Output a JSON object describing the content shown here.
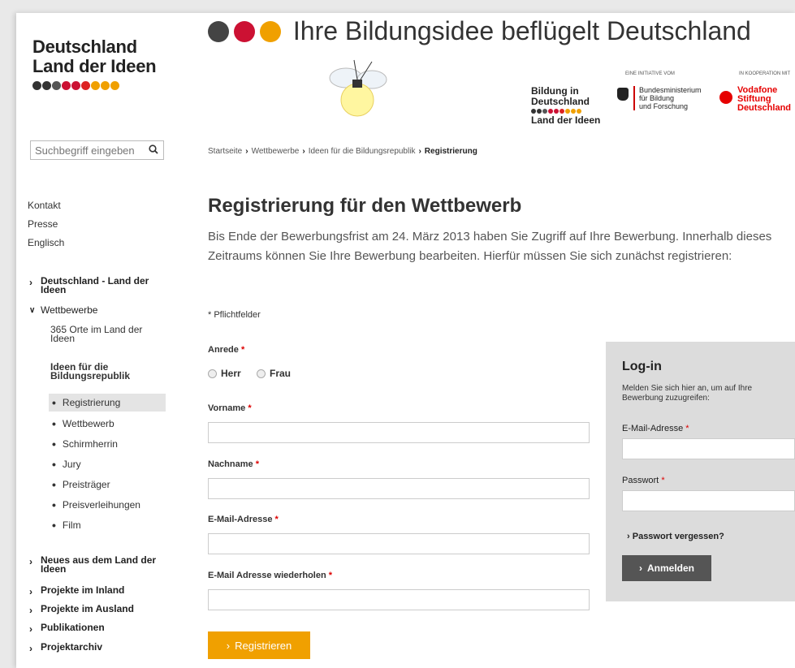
{
  "logo": {
    "line1": "Deutschland",
    "line2": "Land der Ideen",
    "flower_colors": [
      "#333333",
      "#333333",
      "#555555",
      "#cc1133",
      "#cc1133",
      "#dd2222",
      "#f0a000",
      "#f0a000",
      "#f0a000"
    ]
  },
  "banner": {
    "title": "Ihre Bildungsidee beflügelt Deutschland",
    "flower_colors": [
      "#444444",
      "#cc1133",
      "#f0a000"
    ],
    "partner1": {
      "line1": "Bildung in",
      "line2": "Deutschland",
      "line3": "Land der Ideen"
    },
    "initiative_caption": "EINE INITIATIVE VOM",
    "ministry": {
      "line1": "Bundesministerium",
      "line2": "für Bildung",
      "line3": "und Forschung"
    },
    "cooperation_caption": "IN KOOPERATION MIT",
    "vodafone": {
      "line1": "Vodafone",
      "line2": "Stiftung",
      "line3": "Deutschland"
    }
  },
  "search": {
    "placeholder": "Suchbegriff eingeben"
  },
  "util_links": [
    "Kontakt",
    "Presse",
    "Englisch"
  ],
  "nav": {
    "deutschland": "Deutschland - Land der Ideen",
    "wettbewerbe": "Wettbewerbe",
    "orte": "365 Orte im Land der Ideen",
    "ideen": "Ideen für die Bildungsrepublik",
    "bullets": [
      "Registrierung",
      "Wettbewerb",
      "Schirmherrin",
      "Jury",
      "Preisträger",
      "Preisverleihungen",
      "Film"
    ],
    "neues": "Neues aus dem Land der Ideen",
    "inland": "Projekte im Inland",
    "ausland": "Projekte im Ausland",
    "publikationen": "Publikationen",
    "archiv": "Projektarchiv"
  },
  "breadcrumb": [
    "Startseite",
    "Wettbewerbe",
    "Ideen für die Bildungsrepublik",
    "Registrierung"
  ],
  "main": {
    "title": "Registrierung für den Wettbewerb",
    "intro": "Bis Ende der Bewerbungsfrist am 24. März 2013 haben Sie Zugriff auf Ihre Bewerbung. Innerhalb dieses Zeitraums können Sie Ihre Bewerbung bearbeiten. Hierfür müssen Sie sich zunächst registrieren:",
    "required_note": "* Pflichtfelder",
    "anrede_label": "Anrede",
    "herr": "Herr",
    "frau": "Frau",
    "vorname_label": "Vorname",
    "nachname_label": "Nachname",
    "email_label": "E-Mail-Adresse",
    "email_repeat_label": "E-Mail Adresse wiederholen",
    "star": "*",
    "register_button": "Registrieren"
  },
  "login": {
    "title": "Log-in",
    "description": "Melden Sie sich hier an, um auf Ihre Bewerbung zuzugreifen:",
    "email_label": "E-Mail-Adresse",
    "password_label": "Passwort",
    "forgot": "Passwort vergessen?",
    "button": "Anmelden"
  },
  "colors": {
    "accent": "#f0a000",
    "required": "#dd0000",
    "login_bg": "#dcdcdc",
    "vodafone": "#e60000"
  }
}
